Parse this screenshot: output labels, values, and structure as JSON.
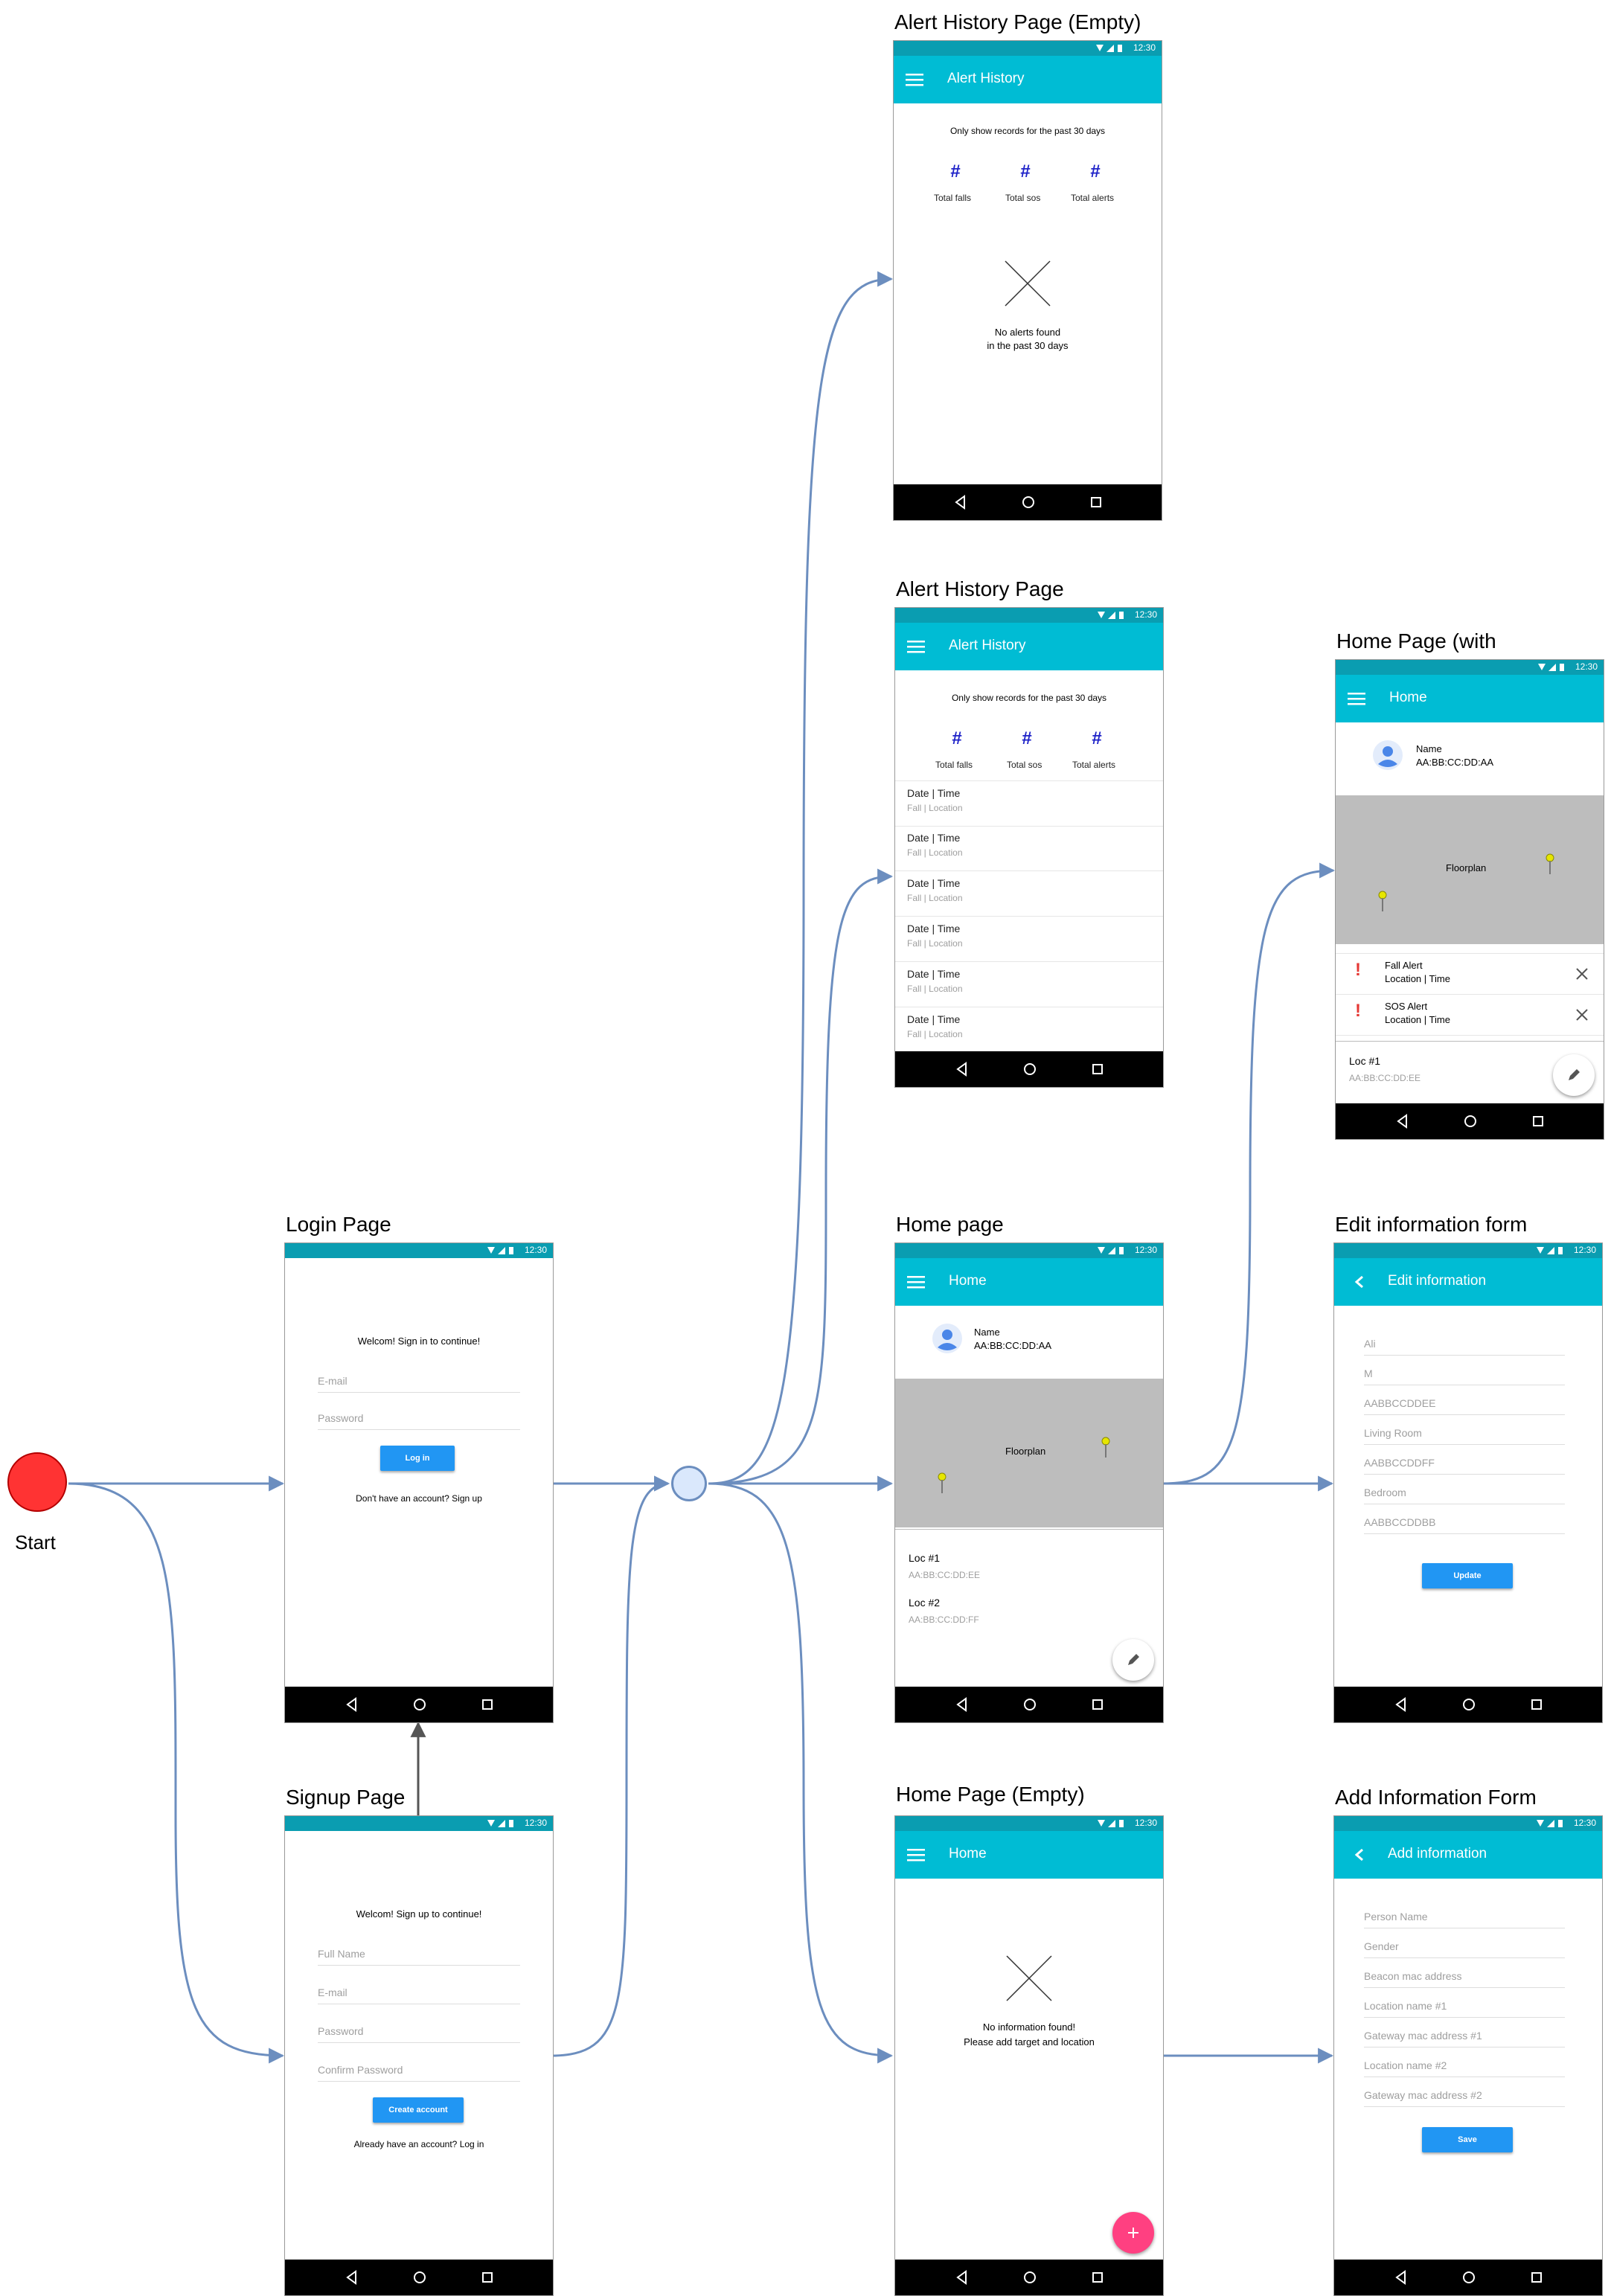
{
  "start": {
    "label": "Start",
    "fill": "#ff3333"
  },
  "status_time": "12:30",
  "screens": {
    "login": {
      "frame_title": "Login Page",
      "welcome": "Welcom! Sign in to continue!",
      "email_placeholder": "E-mail",
      "password_placeholder": "Password",
      "button": "Log in",
      "footer": "Don't have an account? Sign up"
    },
    "signup": {
      "frame_title": "Signup Page",
      "welcome": "Welcom! Sign up to continue!",
      "fullname_placeholder": "Full Name",
      "email_placeholder": "E-mail",
      "password_placeholder": "Password",
      "confirm_placeholder": "Confirm Password",
      "button": "Create account",
      "footer": "Already have an account? Log in"
    },
    "alert_empty": {
      "frame_title": "Alert History Page (Empty)",
      "appbar_title": "Alert History",
      "note": "Only show records for the past 30 days",
      "stats": [
        {
          "value": "#",
          "label": "Total falls"
        },
        {
          "value": "#",
          "label": "Total sos"
        },
        {
          "value": "#",
          "label": "Total alerts"
        }
      ],
      "empty_line1": "No alerts found",
      "empty_line2": "in the past 30 days"
    },
    "alert": {
      "frame_title": "Alert History Page",
      "appbar_title": "Alert History",
      "note": "Only show records for the past 30 days",
      "stats": [
        {
          "value": "#",
          "label": "Total falls"
        },
        {
          "value": "#",
          "label": "Total sos"
        },
        {
          "value": "#",
          "label": "Total alerts"
        }
      ],
      "rows": [
        {
          "primary": "Date | Time",
          "secondary": "Fall | Location"
        },
        {
          "primary": "Date | Time",
          "secondary": "Fall | Location"
        },
        {
          "primary": "Date | Time",
          "secondary": "Fall | Location"
        },
        {
          "primary": "Date | Time",
          "secondary": "Fall | Location"
        },
        {
          "primary": "Date | Time",
          "secondary": "Fall | Location"
        },
        {
          "primary": "Date | Time",
          "secondary": "Fall | Location"
        }
      ]
    },
    "home_alerts": {
      "frame_title": "Home Page (with",
      "appbar_title": "Home",
      "name": "Name",
      "mac": "AA:BB:CC:DD:AA",
      "floorplan": "Floorplan",
      "alerts": [
        {
          "title": "Fall Alert",
          "detail": "Location | Time"
        },
        {
          "title": "SOS Alert",
          "detail": "Location | Time"
        }
      ],
      "loc_name": "Loc #1",
      "loc_mac": "AA:BB:CC:DD:EE"
    },
    "home": {
      "frame_title": "Home page",
      "appbar_title": "Home",
      "name": "Name",
      "mac": "AA:BB:CC:DD:AA",
      "floorplan": "Floorplan",
      "locations": [
        {
          "name": "Loc #1",
          "mac": "AA:BB:CC:DD:EE"
        },
        {
          "name": "Loc #2",
          "mac": "AA:BB:CC:DD:FF"
        }
      ]
    },
    "edit": {
      "frame_title": "Edit information form",
      "appbar_title": "Edit information",
      "fields": [
        "Ali",
        "M",
        "AABBCCDDEE",
        "Living Room",
        "AABBCCDDFF",
        "Bedroom",
        "AABBCCDDBB"
      ],
      "button": "Update"
    },
    "home_empty": {
      "frame_title": "Home Page (Empty)",
      "appbar_title": "Home",
      "empty_line1": "No information found!",
      "empty_line2": "Please add target and location",
      "fab_color": "#ff4081"
    },
    "add": {
      "frame_title": "Add Information Form",
      "appbar_title": "Add information",
      "fields": [
        "Person Name",
        "Gender",
        "Beacon mac address",
        "Location name #1",
        "Gateway mac address #1",
        "Location name #2",
        "Gateway mac address #2"
      ],
      "button": "Save"
    }
  },
  "colors": {
    "status_bar": "#0a9db1",
    "app_bar": "#00bcd4",
    "button": "#2196f3",
    "connector": "#6c8ebf",
    "alert_icon": "#e53935",
    "hub_fill": "#dae8fc"
  }
}
